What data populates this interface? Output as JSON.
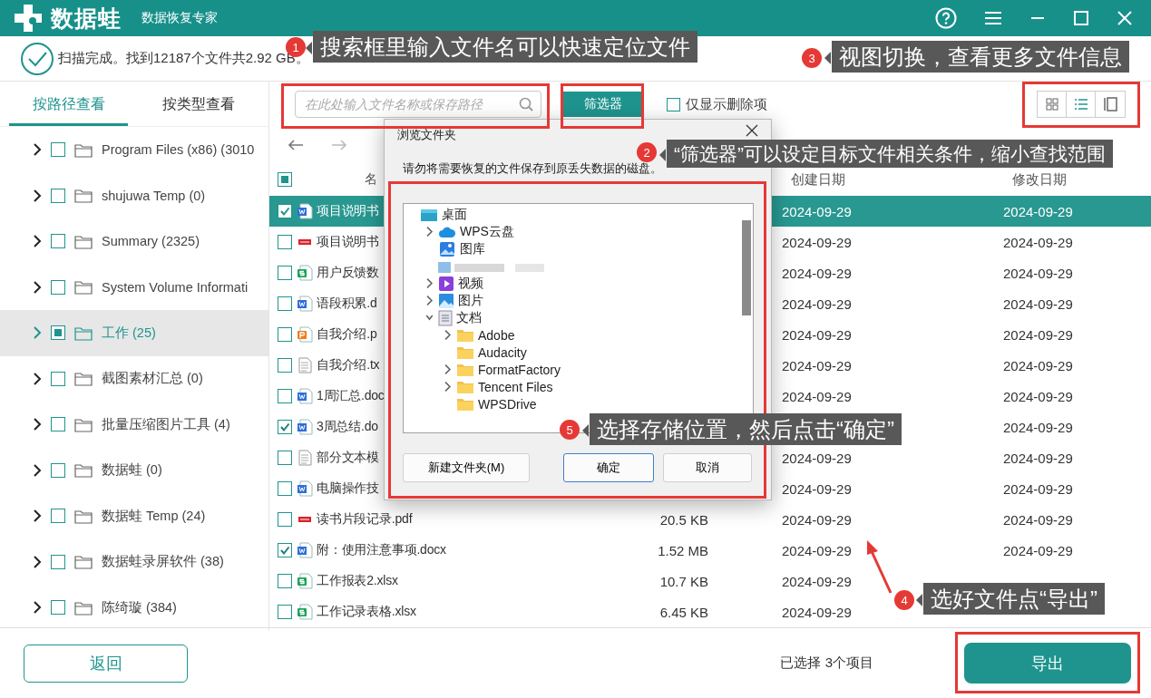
{
  "app": {
    "logo_text": "数据蛙",
    "subtitle": "数据恢复专家"
  },
  "scan_status": "扫描完成。找到12187个文件共2.92 GB。",
  "sidebar": {
    "tabs": [
      {
        "label": "按路径查看",
        "selected": true
      },
      {
        "label": "按类型查看",
        "selected": false
      }
    ],
    "items": [
      {
        "name": "Program Files (x86) (3010",
        "checked": false,
        "partial": false,
        "selected": false
      },
      {
        "name": "shujuwa Temp (0)",
        "checked": false,
        "partial": false,
        "selected": false
      },
      {
        "name": "Summary (2325)",
        "checked": false,
        "partial": false,
        "selected": false
      },
      {
        "name": "System Volume Informati",
        "checked": false,
        "partial": false,
        "selected": false
      },
      {
        "name": "工作 (25)",
        "checked": false,
        "partial": true,
        "selected": true
      },
      {
        "name": "截图素材汇总 (0)",
        "checked": false,
        "partial": false,
        "selected": false
      },
      {
        "name": "批量压缩图片工具 (4)",
        "checked": false,
        "partial": false,
        "selected": false
      },
      {
        "name": "数据蛙 (0)",
        "checked": false,
        "partial": false,
        "selected": false
      },
      {
        "name": "数据蛙 Temp (24)",
        "checked": false,
        "partial": false,
        "selected": false
      },
      {
        "name": "数据蛙录屏软件 (38)",
        "checked": false,
        "partial": false,
        "selected": false
      },
      {
        "name": "陈绮璇 (384)",
        "checked": false,
        "partial": false,
        "selected": false
      }
    ]
  },
  "toolbar": {
    "search": {
      "placeholder": "在此处输入文件名称或保存路径"
    },
    "filter_button": "筛选器",
    "deleted_only": {
      "label": "仅显示删除项",
      "checked": false
    },
    "view_modes": [
      {
        "kind": "grid",
        "selected": false
      },
      {
        "kind": "list",
        "selected": true
      },
      {
        "kind": "columns",
        "selected": false
      }
    ]
  },
  "file_table": {
    "select_all": {
      "checked": false,
      "partial": true
    },
    "columns": [
      "名",
      "创建日期",
      "修改日期"
    ],
    "rows": [
      {
        "name": "项目说明书",
        "kind": "word",
        "checked": true,
        "selected": true,
        "created": "2024-09-29",
        "modified": "2024-09-29"
      },
      {
        "name": "项目说明书",
        "kind": "pdf",
        "checked": false,
        "selected": false,
        "created": "2024-09-29",
        "modified": "2024-09-29"
      },
      {
        "name": "用户反馈数",
        "kind": "sheet",
        "checked": false,
        "selected": false,
        "created": "2024-09-29",
        "modified": "2024-09-29"
      },
      {
        "name": "语段积累.d",
        "kind": "word",
        "checked": false,
        "selected": false,
        "created": "2024-09-29",
        "modified": "2024-09-29"
      },
      {
        "name": "自我介绍.p",
        "kind": "slides",
        "checked": false,
        "selected": false,
        "created": "2024-09-29",
        "modified": "2024-09-29"
      },
      {
        "name": "自我介绍.tx",
        "kind": "text",
        "checked": false,
        "selected": false,
        "created": "2024-09-29",
        "modified": "2024-09-29"
      },
      {
        "name": "1周汇总.doc",
        "kind": "word",
        "checked": false,
        "selected": false,
        "created": "2024-09-29",
        "modified": "2024-09-29"
      },
      {
        "name": "3周总结.do",
        "kind": "word",
        "checked": true,
        "selected": false,
        "modified": "2024-09-29"
      },
      {
        "name": "部分文本模",
        "kind": "text",
        "checked": false,
        "selected": false,
        "created": "2024-09-29",
        "modified": "2024-09-29"
      },
      {
        "name": "电脑操作技",
        "kind": "word",
        "checked": false,
        "selected": false,
        "created": "2024-09-29",
        "modified": "2024-09-29"
      },
      {
        "name": "读书片段记录.pdf",
        "kind": "pdf",
        "checked": false,
        "selected": false,
        "size": "20.5 KB",
        "created": "2024-09-29",
        "modified": "2024-09-29"
      },
      {
        "name": "附：使用注意事项.docx",
        "kind": "word",
        "checked": true,
        "selected": false,
        "size": "1.52 MB",
        "created": "2024-09-29",
        "modified": "2024-09-29"
      },
      {
        "name": "工作报表2.xlsx",
        "kind": "sheet",
        "checked": false,
        "selected": false,
        "size": "10.7 KB",
        "created": "2024-09-29"
      },
      {
        "name": "工作记录表格.xlsx",
        "kind": "sheet",
        "checked": false,
        "selected": false,
        "size": "6.45 KB",
        "created": "2024-09-29"
      }
    ]
  },
  "dialog": {
    "title": "浏览文件夹",
    "message": "请勿将需要恢复的文件保存到原丢失数据的磁盘。",
    "tree": [
      {
        "label": "桌面",
        "kind": "desktop",
        "children": [
          {
            "label": "WPS云盘",
            "kind": "cloud",
            "expanded": false
          },
          {
            "label": "图库",
            "kind": "gallery"
          },
          {
            "kind": "redacted"
          },
          {
            "label": "视频",
            "kind": "video",
            "expanded": false
          },
          {
            "label": "图片",
            "kind": "pictures",
            "expanded": false
          },
          {
            "label": "文档",
            "kind": "documents",
            "expanded": true,
            "children": [
              {
                "label": "Adobe",
                "kind": "folder",
                "expanded": false
              },
              {
                "label": "Audacity",
                "kind": "folder"
              },
              {
                "label": "FormatFactory",
                "kind": "folder",
                "expanded": false
              },
              {
                "label": "Tencent Files",
                "kind": "folder",
                "expanded": false
              },
              {
                "label": "WPSDrive",
                "kind": "folder"
              }
            ]
          }
        ]
      }
    ],
    "buttons": [
      {
        "label": "新建文件夹(M)",
        "default": false
      },
      {
        "label": "确定",
        "default": true
      },
      {
        "label": "取消",
        "default": false
      }
    ]
  },
  "footer": {
    "back_button": "返回",
    "selection_text": "已选择 3个项目",
    "export_button": "导出"
  },
  "annotations": [
    {
      "number": "1",
      "text": "搜索框里输入文件名可以快速定位文件"
    },
    {
      "number": "3",
      "text": "视图切换，查看更多文件信息"
    },
    {
      "number": "2",
      "text": "“筛选器”可以设定目标文件相关条件，缩小查找范围"
    },
    {
      "number": "5",
      "text": "选择存储位置，然后点击“确定”"
    },
    {
      "number": "4",
      "text": "选好文件点“导出”"
    }
  ]
}
